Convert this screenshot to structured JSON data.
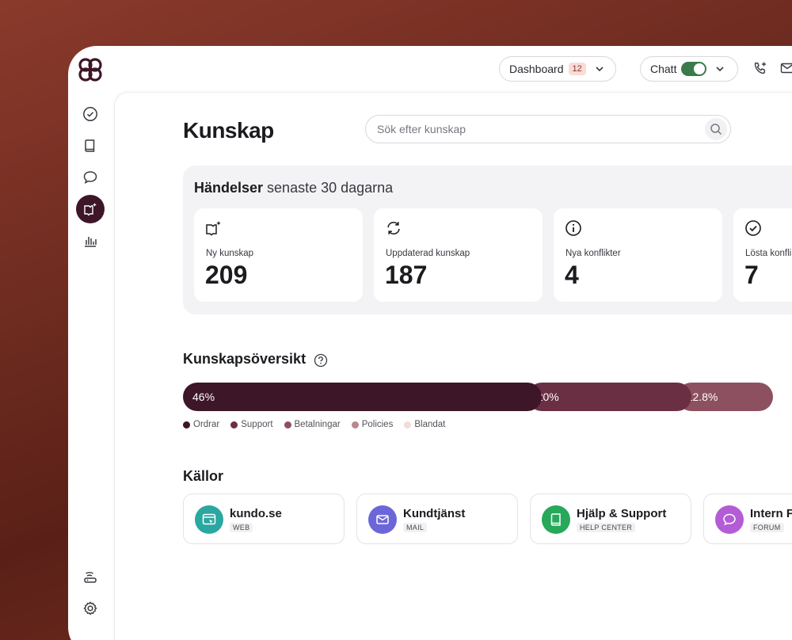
{
  "topbar": {
    "dashboard_label": "Dashboard",
    "dashboard_badge": "12",
    "chat_label": "Chatt"
  },
  "page": {
    "title": "Kunskap"
  },
  "search": {
    "placeholder": "Sök efter kunskap"
  },
  "events": {
    "title_bold": "Händelser",
    "title_rest": " senaste 30 dagarna",
    "cards": [
      {
        "label": "Ny kunskap",
        "value": "209",
        "icon": "book-sparkle-icon"
      },
      {
        "label": "Uppdaterad kunskap",
        "value": "187",
        "icon": "refresh-icon"
      },
      {
        "label": "Nya konflikter",
        "value": "4",
        "icon": "info-icon"
      },
      {
        "label": "Lösta konfli",
        "value": "7",
        "icon": "check-circle-icon"
      }
    ]
  },
  "overview": {
    "title": "Kunskapsöversikt",
    "segments": [
      {
        "label": "46%",
        "value": 46,
        "color": "#3d1628"
      },
      {
        "label": "20%",
        "value": 20,
        "color": "#6b2f44"
      },
      {
        "label": "12.8%",
        "value": 12.8,
        "color": "#8d5060"
      }
    ],
    "legend": [
      {
        "label": "Ordrar",
        "color": "#3d1628"
      },
      {
        "label": "Support",
        "color": "#6b2f44"
      },
      {
        "label": "Betalningar",
        "color": "#8d5060"
      },
      {
        "label": "Policies",
        "color": "#b9878f"
      },
      {
        "label": "Blandat",
        "color": "#f1ddd4"
      }
    ]
  },
  "sources": {
    "title": "Källor",
    "items": [
      {
        "name": "kundo.se",
        "type": "WEB",
        "color": "#2aa7a0",
        "icon": "web-icon"
      },
      {
        "name": "Kundtjänst",
        "type": "MAIL",
        "color": "#6b67d8",
        "icon": "mail-icon"
      },
      {
        "name": "Hjälp & Support",
        "type": "HELP CENTER",
        "color": "#27a85a",
        "icon": "book-icon"
      },
      {
        "name": "Intern Fo",
        "type": "FORUM",
        "color": "#b35cd6",
        "icon": "chat-icon"
      }
    ]
  }
}
